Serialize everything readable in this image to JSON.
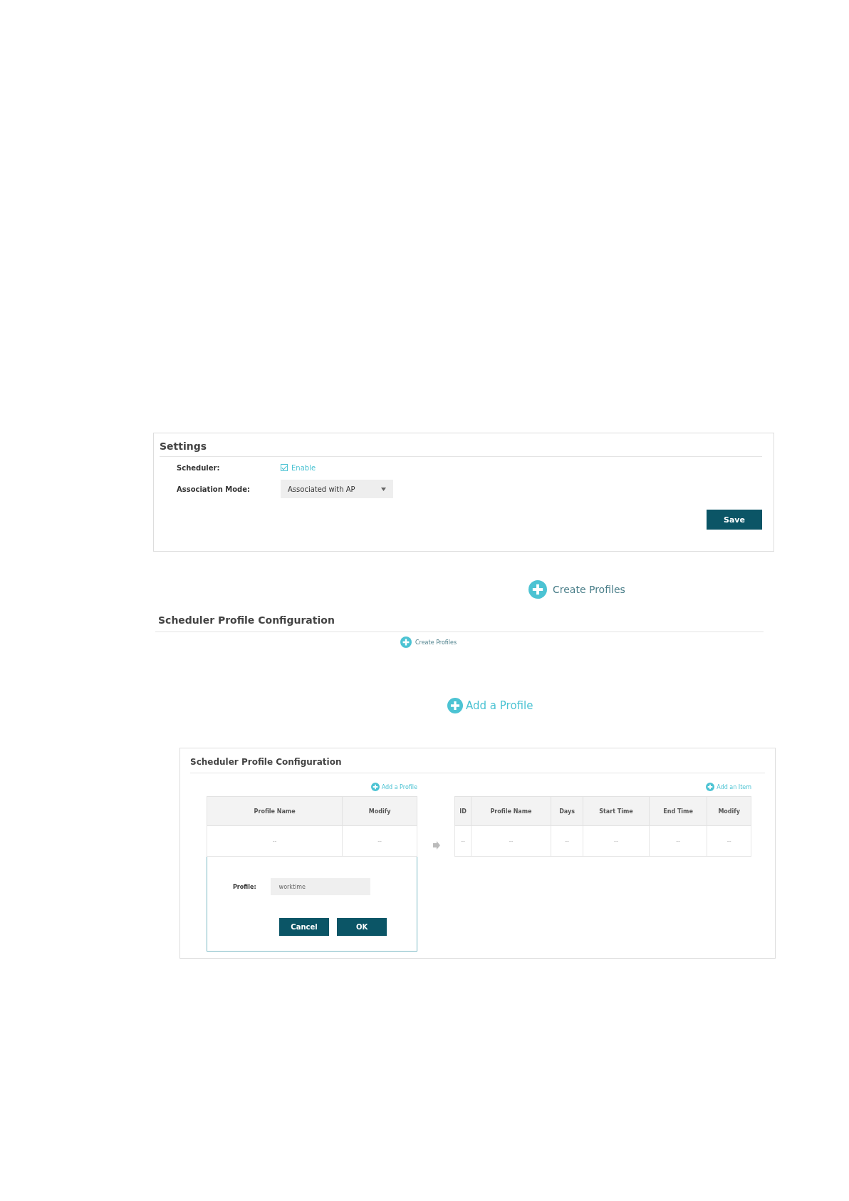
{
  "settings_panel": {
    "title": "Settings",
    "fields": [
      {
        "kind": "checkbox",
        "label": "Scheduler:",
        "option": "Enable",
        "checked": true
      },
      {
        "kind": "select",
        "label": "Association Mode:",
        "value": "Associated with AP"
      }
    ],
    "save_button": "Save"
  },
  "create_profiles_large": "Create Profiles",
  "profile_config_strip": {
    "title": "Scheduler Profile Configuration",
    "create_button": "Create Profiles"
  },
  "add_profile_large": "Add a Profile",
  "config_panel": {
    "title": "Scheduler Profile Configuration",
    "add_profile_button": "Add a Profile",
    "profiles_table": {
      "columns": [
        "Profile Name",
        "Modify"
      ],
      "rows": [
        [
          "--",
          "--"
        ]
      ]
    },
    "profile_form": {
      "label": "Profile:",
      "value": "worktime",
      "buttons": [
        "Cancel",
        "OK"
      ]
    },
    "add_item_button": "Add an Item",
    "entries_table": {
      "columns": [
        "ID",
        "Profile Name",
        "Days",
        "Start Time",
        "End Time",
        "Modify"
      ],
      "rows": [
        [
          "--",
          "--",
          "--",
          "--",
          "--",
          "--"
        ]
      ]
    }
  }
}
